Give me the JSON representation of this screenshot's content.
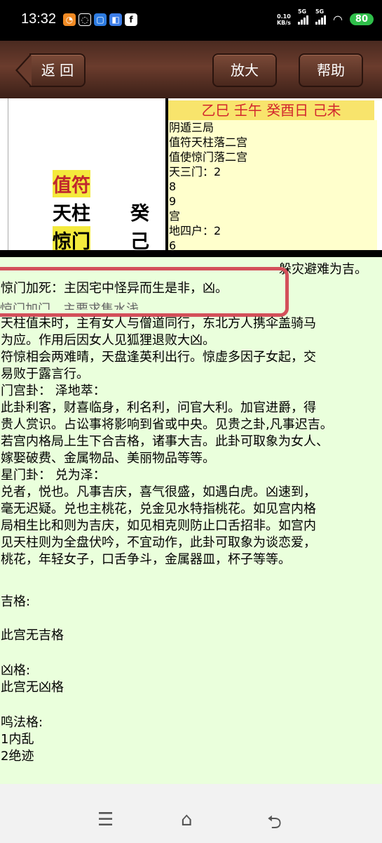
{
  "status": {
    "time": "13:32",
    "net_speed": "0.10",
    "net_unit": "KB/s",
    "sig1": "5G",
    "sig2": "5G",
    "battery": "80"
  },
  "toolbar": {
    "back_label": "返 回",
    "zoom_label": "放大",
    "help_label": "帮助"
  },
  "palace": {
    "label_zhifu": "值符",
    "label_tianzhu": "天柱",
    "label_jingmen": "惊门",
    "stem_top": "癸",
    "stem_bottom": "己",
    "ganzhi": "乙巳 壬午 癸酉日 己未",
    "info": [
      "阴遁三局",
      "值符天柱落二宫",
      "值使惊门落二宫",
      "天三门：2",
      "8",
      "9",
      "宫",
      "地四户：2",
      "6"
    ]
  },
  "content": {
    "partial_top": "躲灾避难为吉。",
    "highlight": "惊门加死：主因宅中怪异而生是非，凶。",
    "partial_cut": "惊门加门，主要求售水浅",
    "lines": [
      "天柱值未时，主有女人与僧道同行，东北方人携伞盖骑马",
      "为应。作用后因女人见狐狸退败大凶。",
      "符惊相会两难晴，天盘逢英利出行。惊虚多因子女起，交",
      "易败于露言行。",
      "门宫卦： 泽地萃：",
      "此卦利客，财喜临身，利名利，问官大利。加官进爵，得",
      "贵人赏识。占讼事将影响到省或中央。见贵之卦,凡事迟吉。",
      "若宫内格局上生下合吉格，诸事大吉。此卦可取象为女人、",
      "嫁娶破费、金属物品、美丽物品等等。",
      "星门卦： 兑为泽：",
      "兑者，悦也。凡事吉庆，喜气很盛，如遇白虎。凶速到，",
      "毫无迟疑。兑也主桃花，兑金见水特指桃花。如见宫内格",
      "局相生比和则为吉庆，如见相克则防止口舌招非。如宫内",
      "见天柱则为全盘伏吟，不宜动作，此卦可取象为谈恋爱，",
      "桃花，年轻女子，口舌争斗，金属器皿，杯子等等。"
    ],
    "ji_title": " 吉格:",
    "ji_value": " 此宫无吉格",
    "xiong_title": " 凶格:",
    "xiong_value": " 此宫无凶格",
    "ming_title": " 鸣法格:",
    "ming_items": [
      " 1内乱",
      " 2绝迹"
    ]
  }
}
